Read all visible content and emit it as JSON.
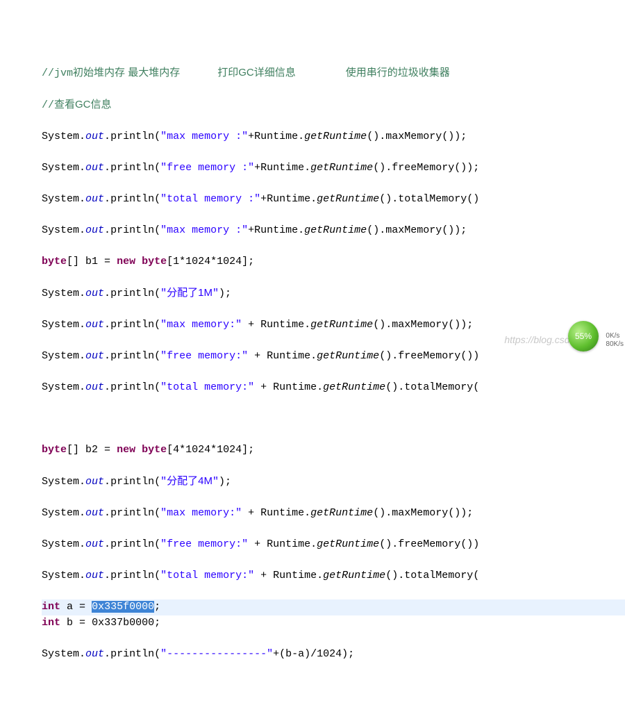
{
  "comments": {
    "c1_prefix": "//",
    "c1_jvm": "jvm",
    "c1_a": "初始堆内存 最大堆内存",
    "c1_spacer1": "      ",
    "c1_b": "打印GC详细信息",
    "c1_spacer2": "        ",
    "c1_c": "使用串行的垃圾收集器",
    "c2_prefix": "//",
    "c2_text": "查看GC信息"
  },
  "code": {
    "system": "System",
    "out": "out",
    "println": "println",
    "runtime": "Runtime",
    "getRuntime": "getRuntime",
    "maxMemory": "maxMemory",
    "freeMemory": "freeMemory",
    "totalMemory": "totalMemory",
    "byte": "byte",
    "intkw": "int",
    "newkw": "new",
    "b1": "b1",
    "b2": "b2",
    "a": "a",
    "b": "b",
    "size1": "1*1024*1024",
    "size4": "4*1024*1024",
    "hex_a": "0x335f0000",
    "hex_b": "0x337b0000",
    "expr_final": "(b-a)/1024"
  },
  "strings": {
    "max_sp": "\"max memory :\"",
    "free_sp": "\"free memory :\"",
    "total_sp": "\"total memory :\"",
    "alloc1_open": "\"",
    "alloc1_cn": "分配了1M",
    "alloc1_close": "\"",
    "max_nosp": "\"max memory:\"",
    "free_nosp": "\"free memory:\"",
    "total_nosp": "\"total memory:\"",
    "alloc4_cn": "分配了4M",
    "dashes": "\"----------------\""
  },
  "watermark": "https://blog.csdn.n",
  "badge": "55%",
  "speed1": "0K/s",
  "speed2": "80K/s"
}
